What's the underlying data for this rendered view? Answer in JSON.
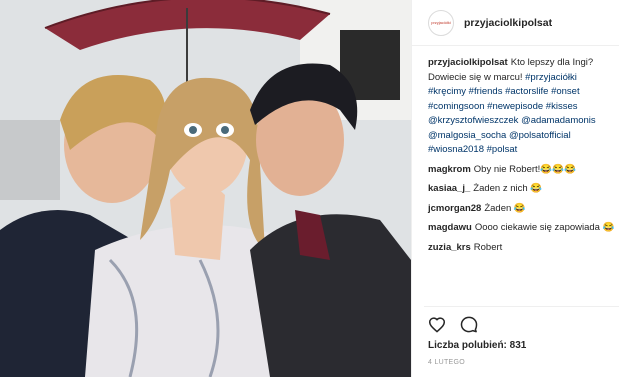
{
  "post": {
    "username": "przyjaciolkipolsat",
    "avatar_text": "przyjaciółki",
    "caption": {
      "username": "przyjaciolkipolsat",
      "text": "Kto lepszy dla Ingi? Dowiecie się w marcu!",
      "tags": [
        "#przyjaciółki",
        "#kręcimy",
        "#friends",
        "#actorslife",
        "#onset",
        "#comingsoon",
        "#newepisode",
        "#kisses",
        "@krzysztofwieszczek",
        "@adamadamonis",
        "@malgosia_socha",
        "@polsatofficial",
        "#wiosna2018",
        "#polsat"
      ]
    },
    "comments": [
      {
        "user": "magkrom",
        "text": "Oby nie Robert!😂😂😂"
      },
      {
        "user": "kasiaa_j_",
        "text": "Żaden z nich 😂"
      },
      {
        "user": "jcmorgan28",
        "text": "Żaden 😂"
      },
      {
        "user": "magdawu",
        "text": "Oooo ciekawie się zapowiada 😂"
      },
      {
        "user": "zuzia_krs",
        "text": "Robert"
      }
    ],
    "likes_label": "Liczba polubień: 831",
    "date": "4 LUTEGO"
  },
  "icons": {
    "like": "heart-icon",
    "comment": "comment-icon"
  },
  "colors": {
    "link": "#003569",
    "umbrella": "#8b2c3a"
  }
}
